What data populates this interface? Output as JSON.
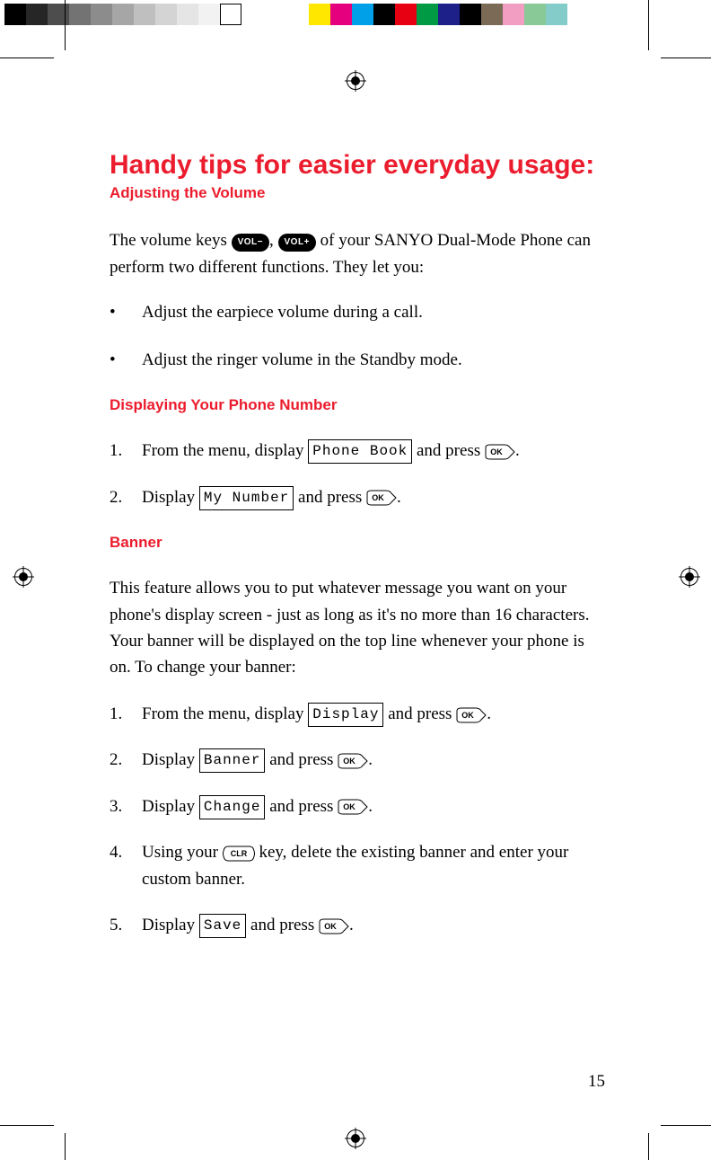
{
  "title": "Handy tips for easier everyday usage:",
  "subtitle": "Adjusting the Volume",
  "intro_pre": "The volume keys ",
  "intro_mid": ", ",
  "intro_post": " of your SANYO Dual-Mode Phone can perform two different functions. They let you:",
  "vol_minus_label": "VOL−",
  "vol_plus_label": "VOL+",
  "bullets": [
    "Adjust the earpiece volume during a call.",
    "Adjust the ringer volume in the Standby mode."
  ],
  "section2": "Displaying Your Phone Number",
  "steps2": {
    "s1_pre": "From the menu, display ",
    "s1_lcd": "Phone Book",
    "s1_post": " and press ",
    "s2_pre": "Display ",
    "s2_lcd": "My Number",
    "s2_post": " and press "
  },
  "section3": "Banner",
  "banner_para": "This feature allows you to put whatever message you want on your phone's display screen - just as long as it's no more than 16 characters. Your banner will be displayed on the top line whenever your phone is on. To change your banner:",
  "steps3": {
    "s1_pre": "From the menu, display ",
    "s1_lcd": "Display",
    "s1_post": " and press ",
    "s2_pre": "Display ",
    "s2_lcd": "Banner",
    "s2_post": " and press ",
    "s3_pre": "Display ",
    "s3_lcd": "Change",
    "s3_post": " and press ",
    "s4_pre": "Using your ",
    "s4_post": " key, delete the existing banner and enter your custom banner.",
    "s5_pre": "Display ",
    "s5_lcd": "Save",
    "s5_post": " and press "
  },
  "ok_label": "OK",
  "clr_label": "CLR",
  "period": ".",
  "page_number": "15"
}
